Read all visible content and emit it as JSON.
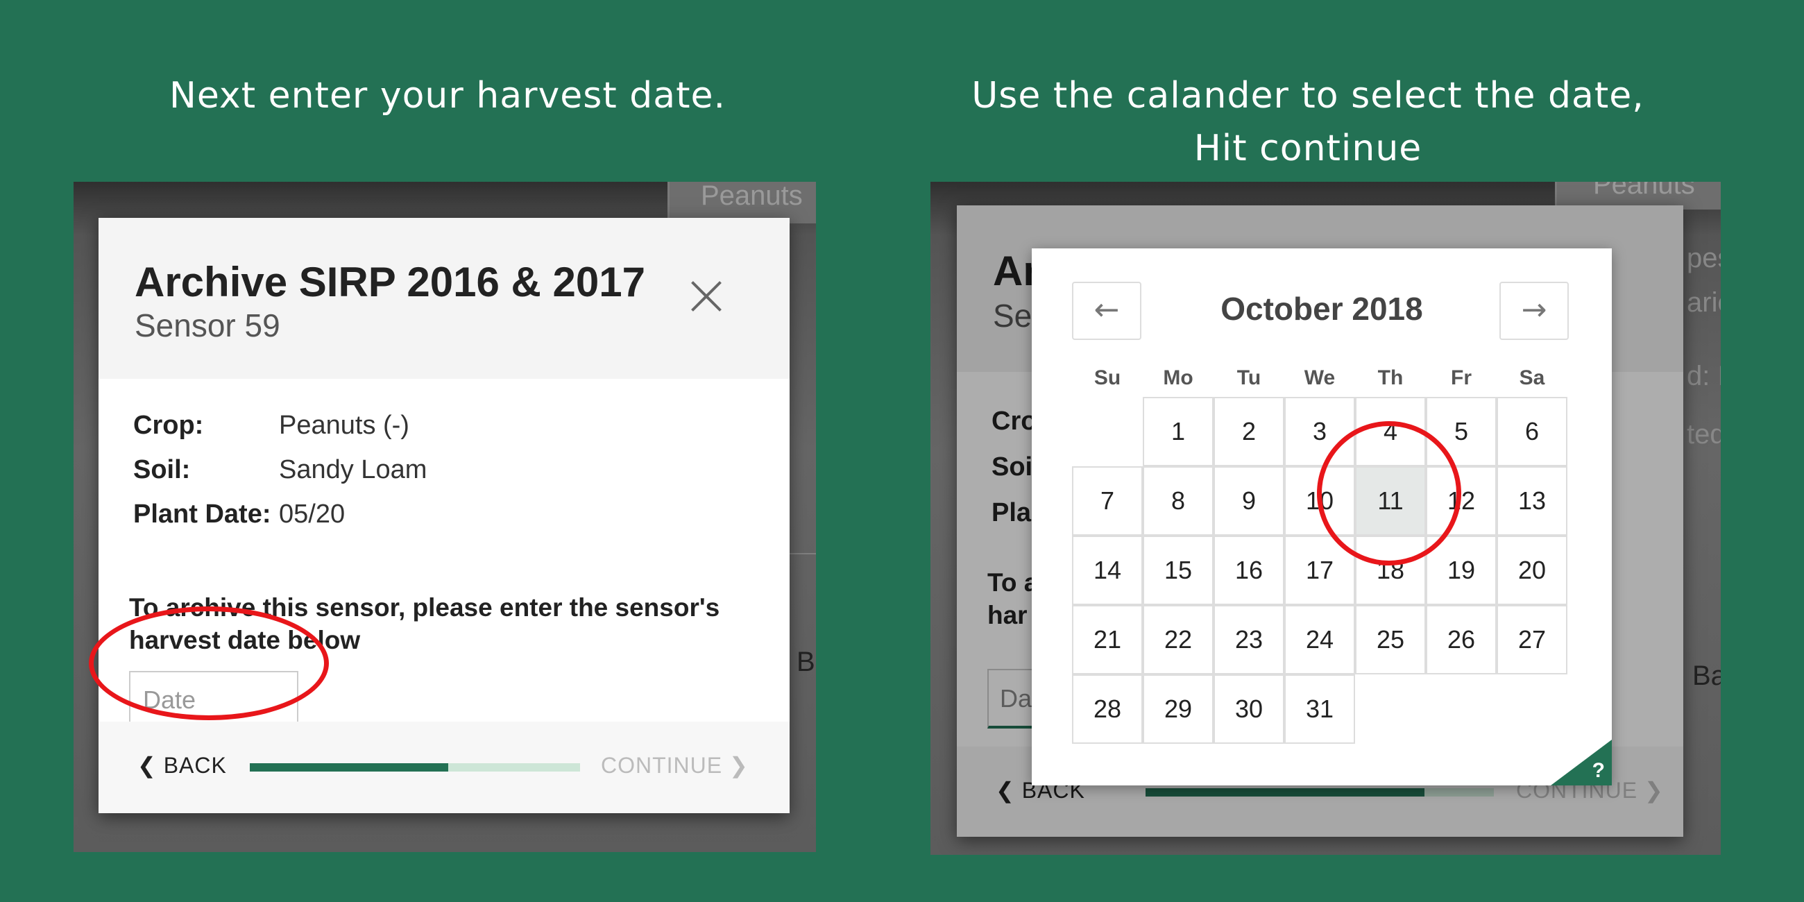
{
  "captions": {
    "left": "Next enter your harvest date.",
    "right_line1": "Use the calander to select the date,",
    "right_line2": "Hit continue"
  },
  "background": {
    "crop_tab": "Peanuts",
    "partial_b": "Ba"
  },
  "modal": {
    "title": "Archive SIRP 2016 & 2017",
    "subtitle": "Sensor 59",
    "crop_label": "Crop:",
    "crop_value": "Peanuts (-)",
    "soil_label": "Soil:",
    "soil_value": "Sandy Loam",
    "plant_label": "Plant Date:",
    "plant_value": "05/20",
    "instruction": "To archive this sensor, please enter the sensor's harvest date below",
    "date_placeholder": "Date",
    "back_label": "BACK",
    "continue_label": "CONTINUE",
    "progress_fraction": 0.6
  },
  "modal_right": {
    "title_partial": "Ar",
    "subtitle_partial": "Se",
    "crop_partial": "Cro",
    "soil_partial": "Soi",
    "plant_partial": "Pla",
    "instr_partial1": "To a",
    "instr_partial2": "har",
    "input_partial": "Da",
    "back_label": "BACK",
    "continue_label": "CONTINUE",
    "progress_fraction": 0.8,
    "bg_right_text": [
      "pes",
      "arie",
      "d: I",
      "ted"
    ]
  },
  "calendar": {
    "month": "October 2018",
    "prev_icon": "←",
    "next_icon": "→",
    "weekdays": [
      "Su",
      "Mo",
      "Tu",
      "We",
      "Th",
      "Fr",
      "Sa"
    ],
    "first_weekday_index": 1,
    "days_in_month": 31,
    "selected_day": 11,
    "help": "?"
  },
  "colors": {
    "brand_green": "#237154",
    "highlight_red": "#e8161a"
  }
}
